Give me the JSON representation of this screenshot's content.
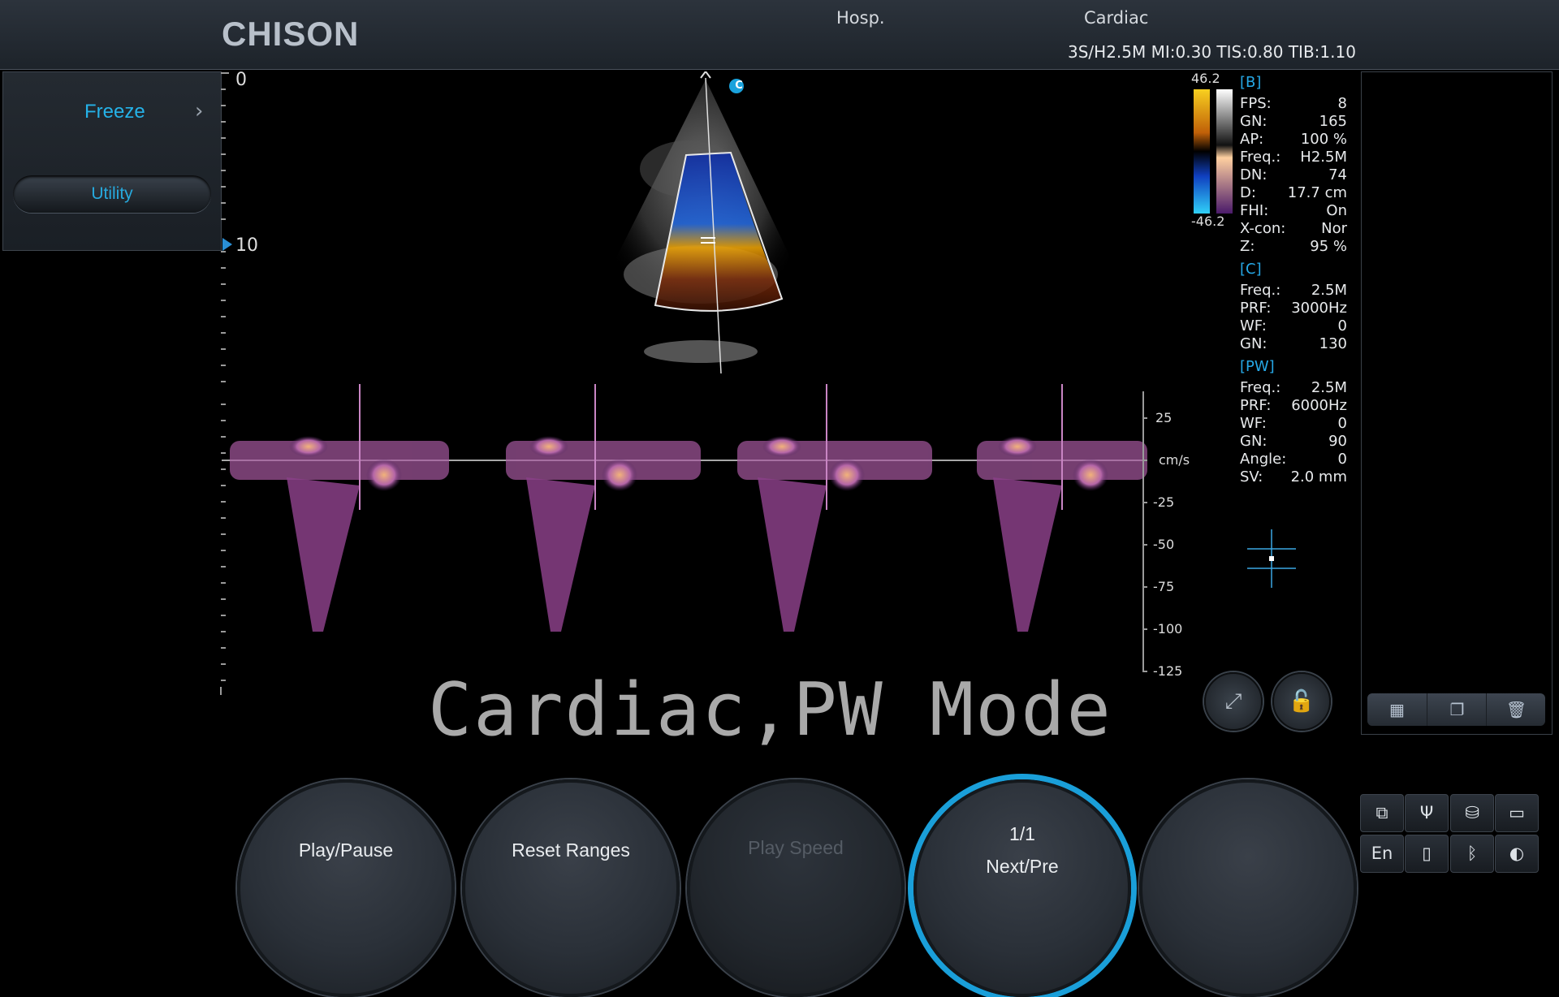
{
  "header": {
    "brand": "CHISON",
    "hospital": "Hosp.",
    "exam": "Cardiac",
    "probe_info": "3S/H2.5M  MI:0.30  TIS:0.80  TIB:1.10"
  },
  "left_panel": {
    "freeze_label": "Freeze",
    "utility_label": "Utility"
  },
  "depth_scale": {
    "top_label": "0",
    "mid_label": "10"
  },
  "color_bar": {
    "max": "46.2",
    "min": "-46.2"
  },
  "info": {
    "b_header": "[B]",
    "b": [
      {
        "k": "FPS:",
        "v": "8"
      },
      {
        "k": "GN:",
        "v": "165"
      },
      {
        "k": "AP:",
        "v": "100 %"
      },
      {
        "k": "Freq.:",
        "v": "H2.5M"
      },
      {
        "k": "DN:",
        "v": "74"
      },
      {
        "k": "D:",
        "v": "17.7 cm"
      },
      {
        "k": "FHI:",
        "v": "On"
      },
      {
        "k": "X-con:",
        "v": "Nor"
      },
      {
        "k": "Z:",
        "v": "95 %"
      }
    ],
    "c_header": "[C]",
    "c": [
      {
        "k": "Freq.:",
        "v": "2.5M"
      },
      {
        "k": "PRF:",
        "v": "3000Hz"
      },
      {
        "k": "WF:",
        "v": "0"
      },
      {
        "k": "GN:",
        "v": "130"
      }
    ],
    "pw_header": "[PW]",
    "pw": [
      {
        "k": "Freq.:",
        "v": "2.5M"
      },
      {
        "k": "PRF:",
        "v": "6000Hz"
      },
      {
        "k": "WF:",
        "v": "0"
      },
      {
        "k": "GN:",
        "v": "90"
      },
      {
        "k": "Angle:",
        "v": "0"
      },
      {
        "k": "SV:",
        "v": "2.0 mm"
      }
    ]
  },
  "velocity_scale": {
    "unit": "cm/s",
    "labels": [
      "25",
      "-25",
      "-50",
      "-75",
      "-100",
      "-125"
    ]
  },
  "cursor_badge": "C",
  "mode_text": "Cardiac,PW Mode",
  "knobs": {
    "k1": "Play/Pause",
    "k2": "Reset Ranges",
    "k3": "Play Speed",
    "k4_top": "1/1",
    "k4_bottom": "Next/Pre"
  },
  "system": {
    "language": "En"
  },
  "colors": {
    "accent": "#26a8e6",
    "background": "#000000",
    "doppler": "#b566a8"
  }
}
